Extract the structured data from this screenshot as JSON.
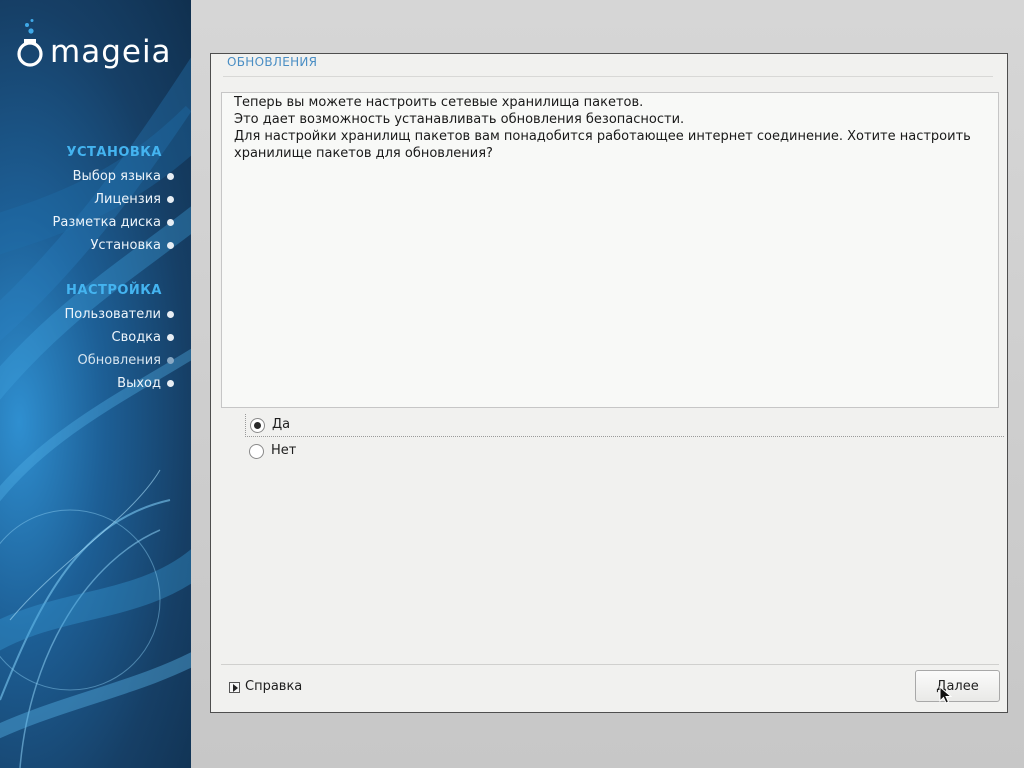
{
  "brand": {
    "name": "mageia",
    "color": "#ffffff"
  },
  "sidebar": {
    "groups": [
      {
        "heading": "УСТАНОВКА",
        "items": [
          {
            "label": "Выбор языка"
          },
          {
            "label": "Лицензия"
          },
          {
            "label": "Разметка диска"
          },
          {
            "label": "Установка"
          }
        ]
      },
      {
        "heading": "НАСТРОЙКА",
        "items": [
          {
            "label": "Пользователи"
          },
          {
            "label": "Сводка"
          },
          {
            "label": "Обновления",
            "current": true
          },
          {
            "label": "Выход"
          }
        ]
      }
    ],
    "heading_color": "#44b4f0"
  },
  "page": {
    "title": "ОБНОВЛЕНИЯ"
  },
  "message": {
    "lines": [
      "Теперь вы можете настроить сетевые хранилища пакетов.",
      "Это дает возможность устанавливать обновления безопасности.",
      "Для настройки хранилищ пакетов вам понадобится работающее интернет соединение. Хотите настроить",
      "хранилище пакетов для обновления?"
    ]
  },
  "options": {
    "yes": {
      "label": "Да",
      "checked": true
    },
    "no": {
      "label": "Нет",
      "checked": false
    }
  },
  "footer": {
    "help_label": "Справка",
    "next_label": "Далее",
    "help_icon": "expander-arrow-icon"
  }
}
